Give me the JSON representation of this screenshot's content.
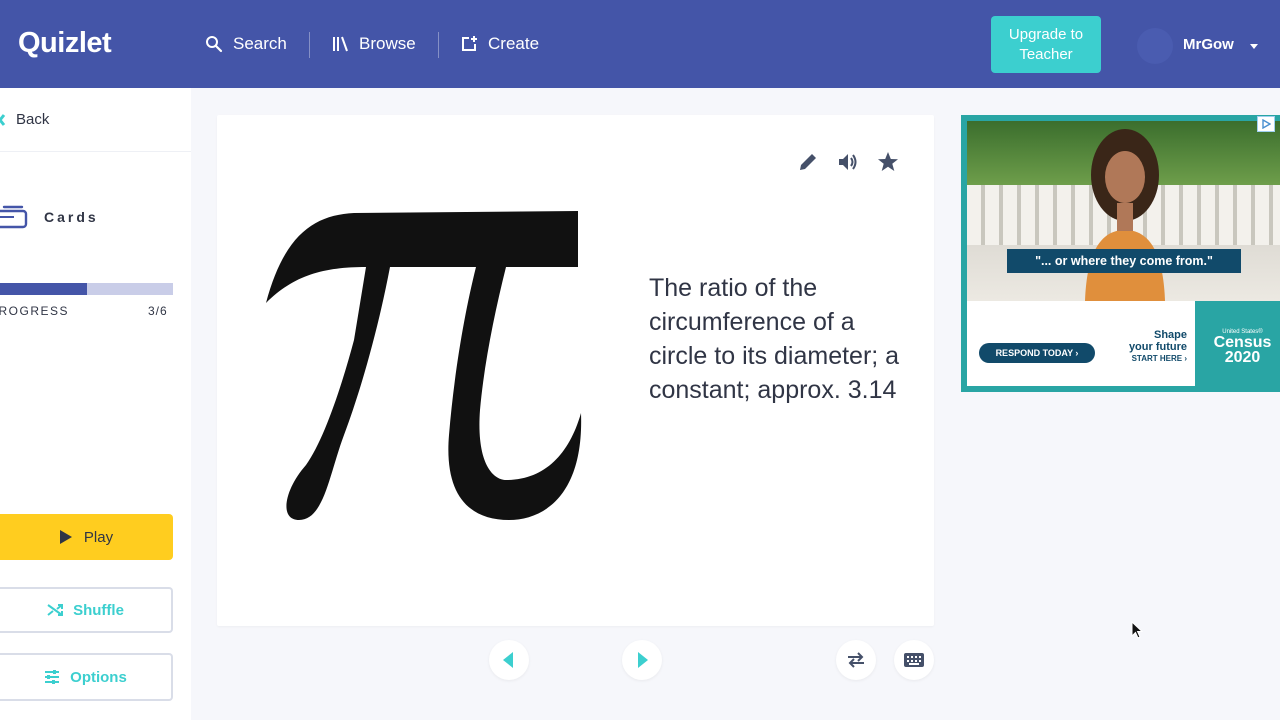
{
  "header": {
    "logo": "Quizlet",
    "search_label": "Search",
    "browse_label": "Browse",
    "create_label": "Create",
    "upgrade_label": "Upgrade to Teacher",
    "username": "MrGow"
  },
  "sidebar": {
    "back_label": "Back",
    "mode_label": "Cards",
    "progress_label": "PROGRESS",
    "progress_current": 3,
    "progress_total": 6,
    "progress_text": "3/6",
    "play_label": "Play",
    "shuffle_label": "Shuffle",
    "options_label": "Options"
  },
  "card": {
    "image_icon": "pi-symbol",
    "definition": "The ratio of the circumference of a circle to its diameter; a constant; approx. 3.14",
    "tools": [
      "pencil-icon",
      "speaker-icon",
      "star-icon"
    ]
  },
  "controls": [
    "prev-arrow-icon",
    "next-arrow-icon",
    "swap-icon",
    "keyboard-icon"
  ],
  "ad": {
    "quote": "\"... or where they come from.\"",
    "respond": "RESPOND TODAY ›",
    "shape_line1": "Shape",
    "shape_line2": "your future",
    "shape_line3": "START HERE ›",
    "census_small": "United States®",
    "census_line1": "Census",
    "census_line2": "2020"
  },
  "colors": {
    "brand": "#4455a8",
    "accent": "#3ccfcf",
    "play": "#ffcd1f"
  }
}
